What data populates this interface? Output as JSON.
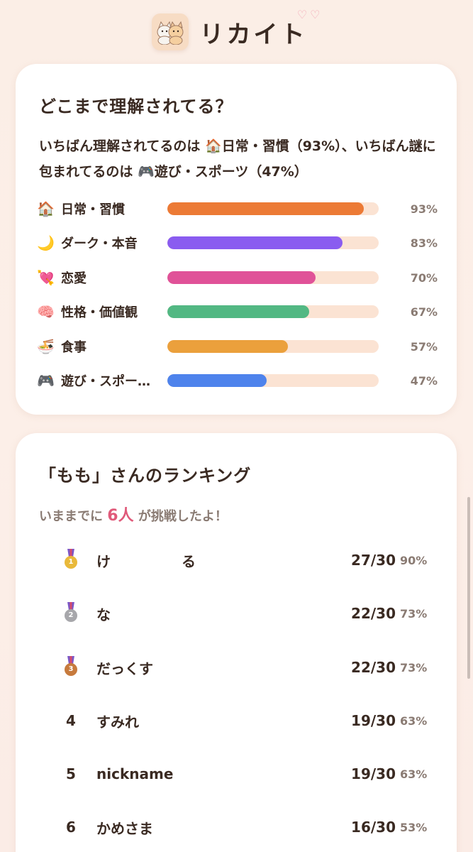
{
  "app": {
    "title": "リカイト",
    "logo_icon": "cat-pair-icon"
  },
  "understanding": {
    "title": "どこまで理解されてる？",
    "summary": "いちばん理解されてるのは 🏠日常・習慣（93%）、いちばん謎に包まれてるのは 🎮遊び・スポーツ（47%）",
    "categories": [
      {
        "emoji": "🏠",
        "label": "日常・習慣",
        "percent": 93,
        "percent_label": "93%",
        "color": "#ec7a35"
      },
      {
        "emoji": "🌙",
        "label": "ダーク・本音",
        "percent": 83,
        "percent_label": "83%",
        "color": "#8a5cf0"
      },
      {
        "emoji": "💘",
        "label": "恋愛",
        "percent": 70,
        "percent_label": "70%",
        "color": "#e05298"
      },
      {
        "emoji": "🧠",
        "label": "性格・価値観",
        "percent": 67,
        "percent_label": "67%",
        "color": "#52b883"
      },
      {
        "emoji": "🍜",
        "label": "食事",
        "percent": 57,
        "percent_label": "57%",
        "color": "#eba03c"
      },
      {
        "emoji": "🎮",
        "label": "遊び・スポー…",
        "percent": 47,
        "percent_label": "47%",
        "color": "#4e83ec"
      }
    ]
  },
  "ranking": {
    "title": "「もも」さんのランキング",
    "challenge_prefix": "いままでに",
    "challenge_count": "6人",
    "challenge_suffix": "が挑戦したよ！",
    "rows": [
      {
        "rank": "1",
        "medal": "gold",
        "name": "け　　　　　る",
        "score": "27/30",
        "percent": "90%"
      },
      {
        "rank": "2",
        "medal": "silver",
        "name": "な",
        "score": "22/30",
        "percent": "73%"
      },
      {
        "rank": "3",
        "medal": "bronze",
        "name": "だっくす",
        "score": "22/30",
        "percent": "73%"
      },
      {
        "rank": "4",
        "medal": "",
        "name": "すみれ",
        "score": "19/30",
        "percent": "63%"
      },
      {
        "rank": "5",
        "medal": "",
        "name": "nickname",
        "score": "19/30",
        "percent": "63%"
      },
      {
        "rank": "6",
        "medal": "",
        "name": "かめさま",
        "score": "16/30",
        "percent": "53%"
      }
    ]
  },
  "colors": {
    "gold": "#e9b93a",
    "silver": "#a7a7ab",
    "bronze": "#c77a3d"
  }
}
